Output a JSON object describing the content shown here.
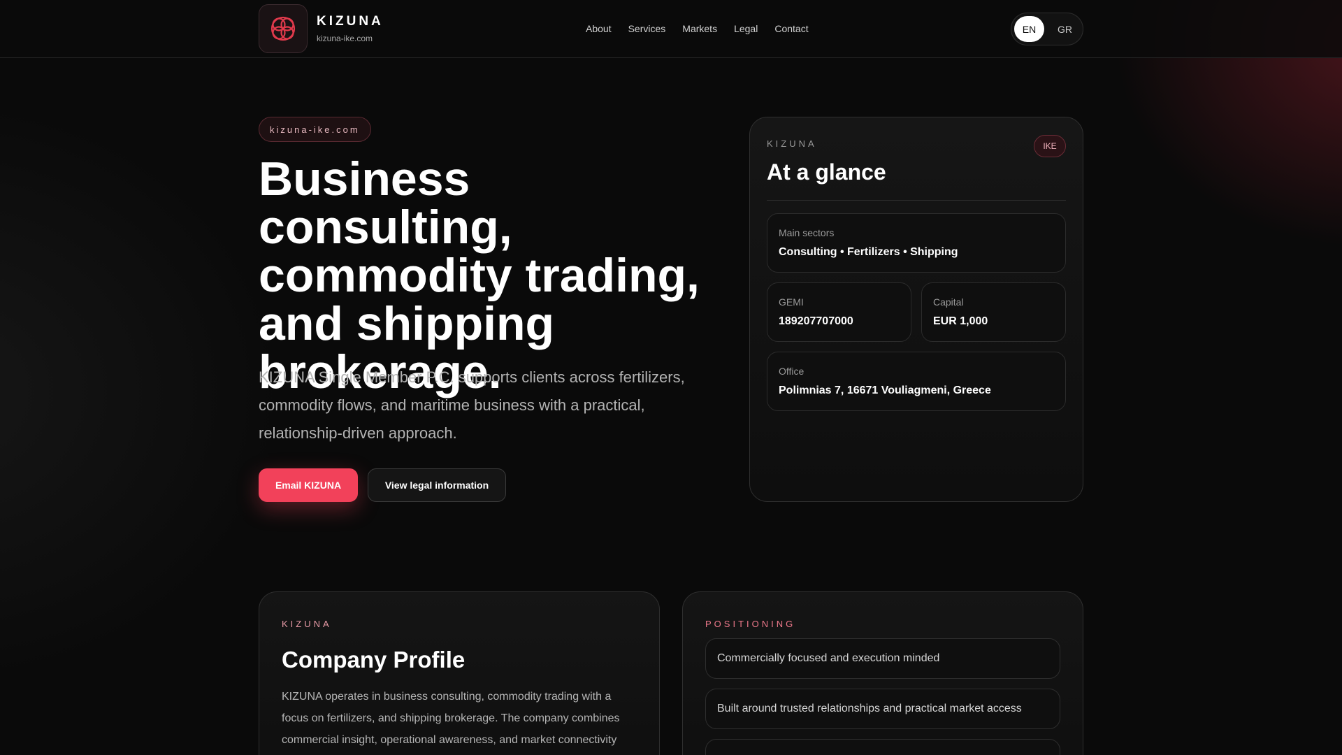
{
  "header": {
    "brand_name": "KIZUNA",
    "brand_domain": "kizuna-ike.com",
    "logo_icon": "knot-emblem-icon",
    "nav": [
      {
        "label": "About"
      },
      {
        "label": "Services"
      },
      {
        "label": "Markets"
      },
      {
        "label": "Legal"
      },
      {
        "label": "Contact"
      }
    ],
    "languages": [
      {
        "label": "EN",
        "active": true
      },
      {
        "label": "GR",
        "active": false
      }
    ]
  },
  "hero": {
    "pill": "kizuna-ike.com",
    "title": "Business consulting, commodity trading, and shipping brokerage.",
    "description": "KIZUNA Single Member P.C. supports clients across fertilizers, commodity flows, and maritime business with a practical, relationship-driven approach.",
    "primary_button": "Email KIZUNA",
    "secondary_button": "View legal information"
  },
  "glance": {
    "eyebrow": "KIZUNA",
    "title": "At a glance",
    "badge": "IKE",
    "sectors": {
      "label": "Main sectors",
      "value": "Consulting • Fertilizers • Shipping"
    },
    "gemi": {
      "label": "GEMI",
      "value": "189207707000"
    },
    "capital": {
      "label": "Capital",
      "value": "EUR 1,000"
    },
    "office": {
      "label": "Office",
      "value": "Polimnias 7, 16671 Vouliagmeni, Greece"
    }
  },
  "profile": {
    "eyebrow": "KIZUNA",
    "title": "Company Profile",
    "body": "KIZUNA operates in business consulting, commodity trading with a focus on fertilizers, and shipping brokerage. The company combines commercial insight, operational awareness, and market connectivity"
  },
  "positioning": {
    "eyebrow": "POSITIONING",
    "items": [
      {
        "text": "Commercially focused and execution minded"
      },
      {
        "text": "Built around trusted relationships and practical market access"
      },
      {
        "text": ""
      }
    ]
  },
  "colors": {
    "accent": "#f2415a",
    "background": "#0a0a0a",
    "card": "#151515",
    "badge_text": "#f0b3bd"
  }
}
